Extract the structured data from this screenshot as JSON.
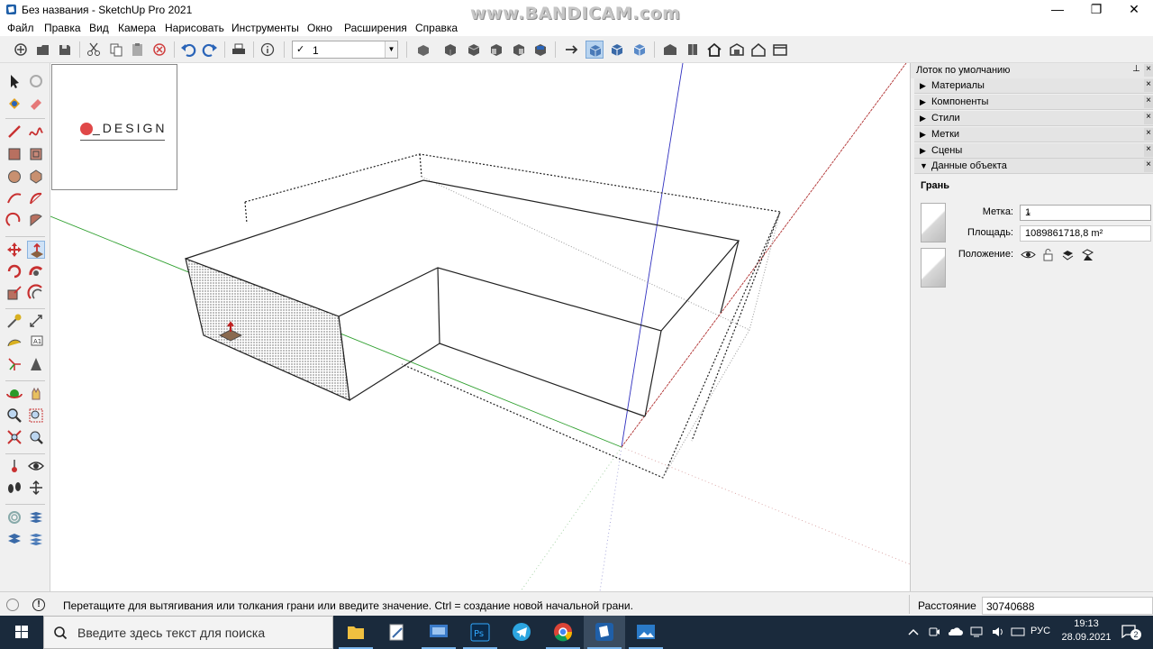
{
  "window": {
    "title": "Без названия - SketchUp Pro 2021",
    "watermark": "www.BANDICAM.com",
    "minimize": "—",
    "maximize": "❐",
    "close": "✕"
  },
  "menu": [
    "Файл",
    "Правка",
    "Вид",
    "Камера",
    "Нарисовать",
    "Инструменты",
    "Окно",
    "Расширения",
    "Справка"
  ],
  "toolbar": {
    "layer_check": "✓",
    "layer_value": "1"
  },
  "viewport": {
    "logo_text": "_DESIGN",
    "accent_color": "#e04848"
  },
  "tray": {
    "title": "Лоток по умолчанию",
    "pin": "⊥",
    "close": "×",
    "panels": [
      {
        "label": "Материалы",
        "expanded": false
      },
      {
        "label": "Компоненты",
        "expanded": false
      },
      {
        "label": "Стили",
        "expanded": false
      },
      {
        "label": "Метки",
        "expanded": false
      },
      {
        "label": "Сцены",
        "expanded": false
      },
      {
        "label": "Данные объекта",
        "expanded": true
      }
    ],
    "entity": {
      "type": "Грань",
      "tag_label": "Метка:",
      "tag_value": "1",
      "area_label": "Площадь:",
      "area_value": "1089861718,8 m²",
      "position_label": "Положение:"
    }
  },
  "status": {
    "message": "Перетащите для вытягивания или толкания грани или введите значение.  Ctrl = создание новой начальной грани.",
    "measure_label": "Расстояние",
    "measure_value": "30740688"
  },
  "taskbar": {
    "search_placeholder": "Введите здесь текст для поиска",
    "lang": "РУС",
    "time": "19:13",
    "date": "28.09.2021",
    "notifications": "2"
  }
}
